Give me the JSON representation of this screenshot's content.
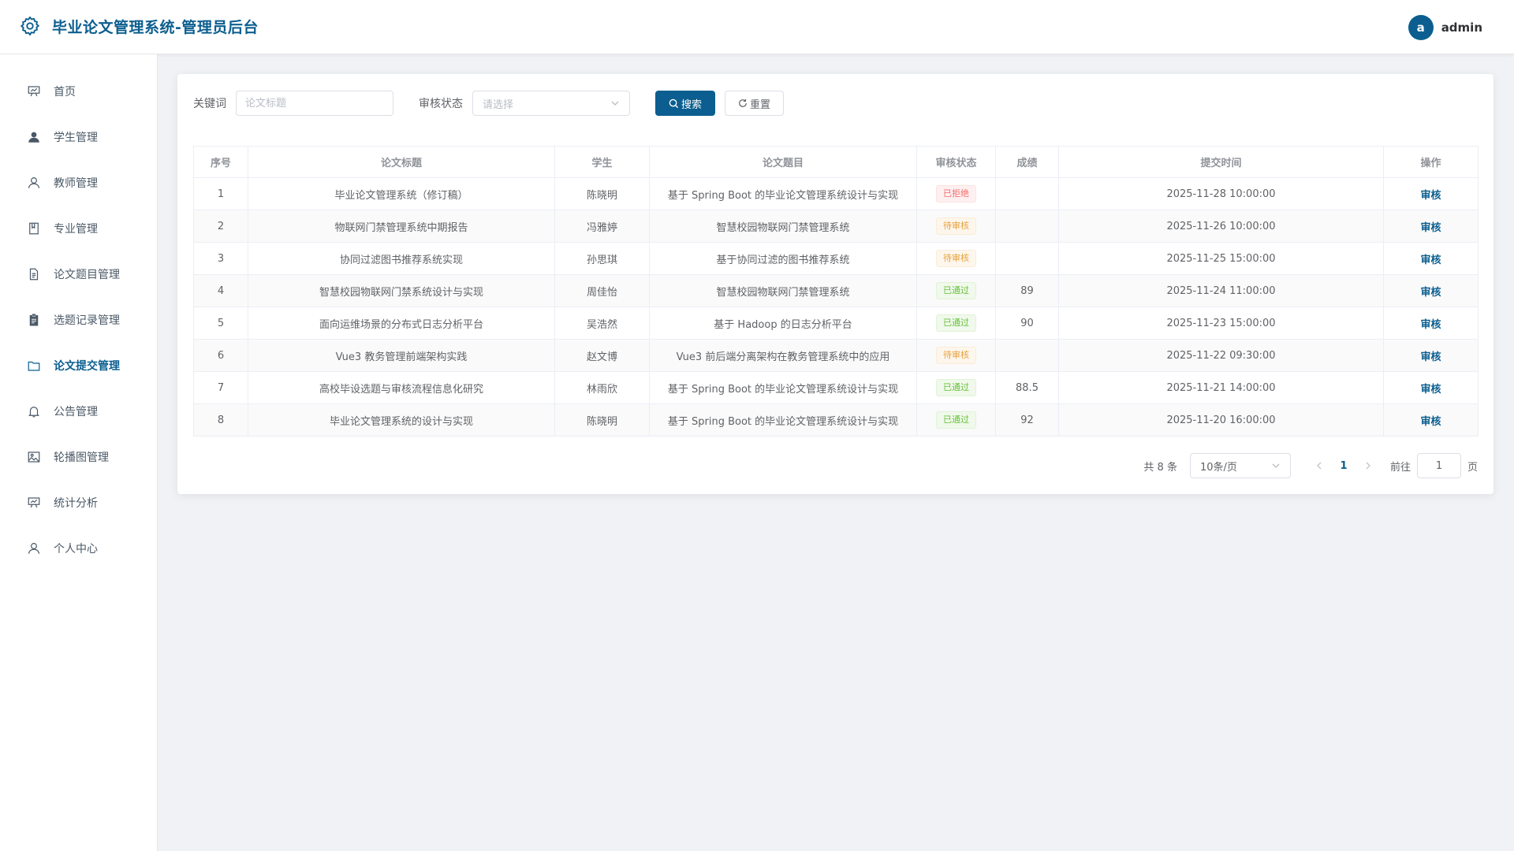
{
  "header": {
    "title": "毕业论文管理系统-管理员后台",
    "avatar_letter": "a",
    "username": "admin",
    "accent_color": "#0b5e8f"
  },
  "sidebar": {
    "items": [
      {
        "label": "首页",
        "icon": "home-icon",
        "active": false
      },
      {
        "label": "学生管理",
        "icon": "user-filled-icon",
        "active": false
      },
      {
        "label": "教师管理",
        "icon": "user-icon",
        "active": false
      },
      {
        "label": "专业管理",
        "icon": "notebook-icon",
        "active": false
      },
      {
        "label": "论文题目管理",
        "icon": "document-icon",
        "active": false
      },
      {
        "label": "选题记录管理",
        "icon": "clipboard-icon",
        "active": false
      },
      {
        "label": "论文提交管理",
        "icon": "folder-icon",
        "active": true
      },
      {
        "label": "公告管理",
        "icon": "bell-icon",
        "active": false
      },
      {
        "label": "轮播图管理",
        "icon": "picture-icon",
        "active": false
      },
      {
        "label": "统计分析",
        "icon": "chart-icon",
        "active": false
      },
      {
        "label": "个人中心",
        "icon": "user-icon",
        "active": false
      }
    ]
  },
  "filters": {
    "keyword_label": "关键词",
    "keyword_placeholder": "论文标题",
    "keyword_value": "",
    "status_label": "审核状态",
    "status_placeholder": "请选择",
    "search_label": "搜索",
    "reset_label": "重置"
  },
  "table": {
    "columns": [
      "序号",
      "论文标题",
      "学生",
      "论文题目",
      "审核状态",
      "成绩",
      "提交时间",
      "操作"
    ],
    "action_label": "审核",
    "rows": [
      {
        "index": "1",
        "title": "毕业论文管理系统（修订稿）",
        "student": "陈晓明",
        "topic": "基于 Spring Boot 的毕业论文管理系统设计与实现",
        "status": "已拒绝",
        "status_type": "rejected",
        "score": "",
        "time": "2025-11-28 10:00:00"
      },
      {
        "index": "2",
        "title": "物联网门禁管理系统中期报告",
        "student": "冯雅婷",
        "topic": "智慧校园物联网门禁管理系统",
        "status": "待审核",
        "status_type": "pending",
        "score": "",
        "time": "2025-11-26 10:00:00"
      },
      {
        "index": "3",
        "title": "协同过滤图书推荐系统实现",
        "student": "孙思琪",
        "topic": "基于协同过滤的图书推荐系统",
        "status": "待审核",
        "status_type": "pending",
        "score": "",
        "time": "2025-11-25 15:00:00"
      },
      {
        "index": "4",
        "title": "智慧校园物联网门禁系统设计与实现",
        "student": "周佳怡",
        "topic": "智慧校园物联网门禁管理系统",
        "status": "已通过",
        "status_type": "approved",
        "score": "89",
        "time": "2025-11-24 11:00:00"
      },
      {
        "index": "5",
        "title": "面向运维场景的分布式日志分析平台",
        "student": "吴浩然",
        "topic": "基于 Hadoop 的日志分析平台",
        "status": "已通过",
        "status_type": "approved",
        "score": "90",
        "time": "2025-11-23 15:00:00"
      },
      {
        "index": "6",
        "title": "Vue3 教务管理前端架构实践",
        "student": "赵文博",
        "topic": "Vue3 前后端分离架构在教务管理系统中的应用",
        "status": "待审核",
        "status_type": "pending",
        "score": "",
        "time": "2025-11-22 09:30:00"
      },
      {
        "index": "7",
        "title": "高校毕设选题与审核流程信息化研究",
        "student": "林雨欣",
        "topic": "基于 Spring Boot 的毕业论文管理系统设计与实现",
        "status": "已通过",
        "status_type": "approved",
        "score": "88.5",
        "time": "2025-11-21 14:00:00"
      },
      {
        "index": "8",
        "title": "毕业论文管理系统的设计与实现",
        "student": "陈晓明",
        "topic": "基于 Spring Boot 的毕业论文管理系统设计与实现",
        "status": "已通过",
        "status_type": "approved",
        "score": "92",
        "time": "2025-11-20 16:00:00"
      }
    ]
  },
  "pagination": {
    "total_text": "共 8 条",
    "page_size": "10条/页",
    "current_page": "1",
    "goto_label": "前往",
    "goto_value": "1",
    "page_unit": "页"
  }
}
